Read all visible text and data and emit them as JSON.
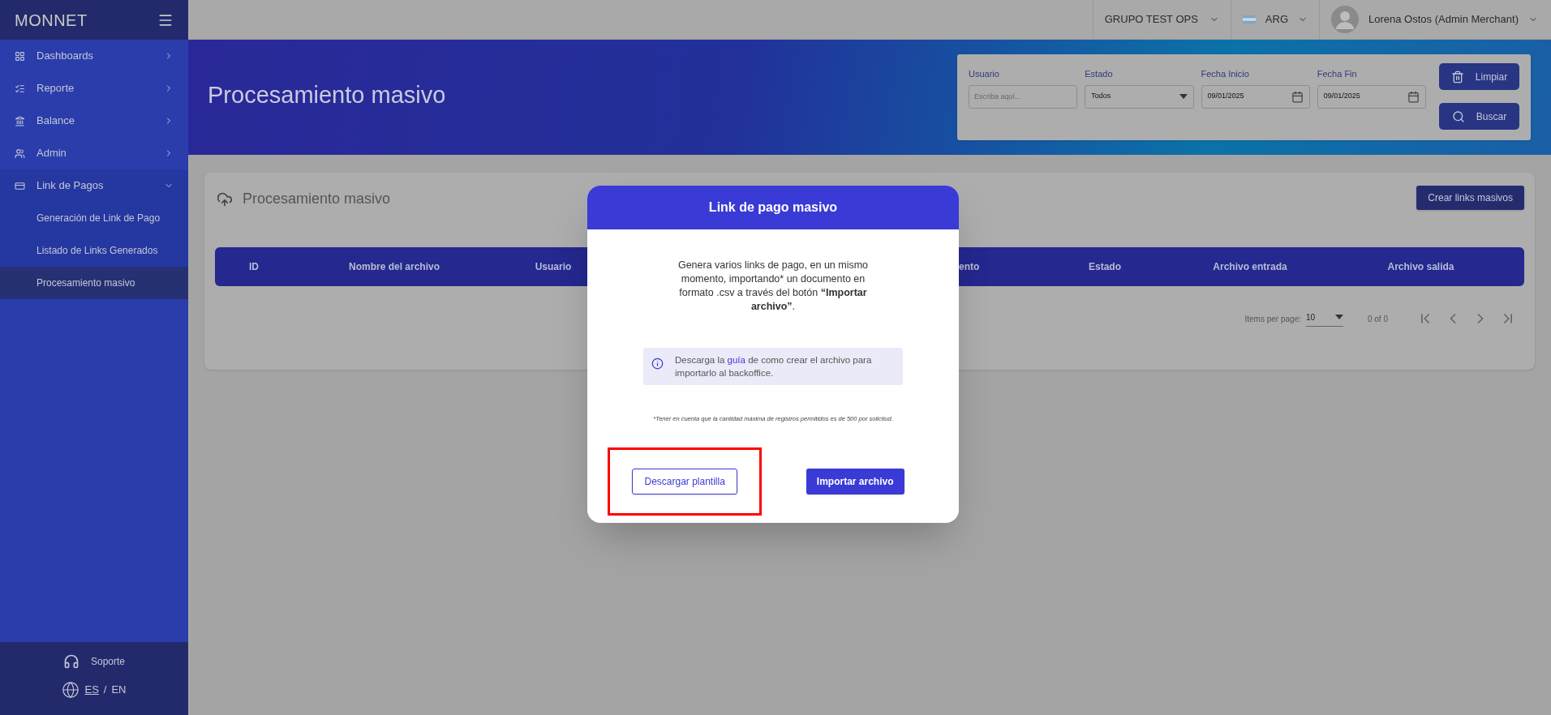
{
  "sidebar": {
    "logo": "MONNET",
    "items": [
      {
        "label": "Dashboards",
        "kind": "dashboards",
        "expanded": false
      },
      {
        "label": "Reporte",
        "kind": "report",
        "expanded": false
      },
      {
        "label": "Balance",
        "kind": "balance",
        "expanded": false
      },
      {
        "label": "Admin",
        "kind": "admin",
        "expanded": false
      },
      {
        "label": "Link de Pagos",
        "kind": "payments",
        "expanded": true,
        "children": [
          {
            "label": "Generación de Link de Pago",
            "selected": false
          },
          {
            "label": "Listado de Links Generados",
            "selected": false
          },
          {
            "label": "Procesamiento masivo",
            "selected": true
          }
        ]
      }
    ],
    "support": "Soporte",
    "languages": [
      {
        "label": "ES",
        "selected": true
      },
      {
        "label": "EN",
        "selected": false
      }
    ],
    "language_separator": "/"
  },
  "topbar": {
    "group": "GRUPO TEST OPS",
    "country": "ARG",
    "user": "Lorena Ostos (Admin Merchant)"
  },
  "page_title": "Procesamiento masivo",
  "filters": {
    "fields": [
      {
        "label": "Usuario",
        "kind": "text",
        "placeholder": "Escriba aquí..."
      },
      {
        "label": "Estado",
        "kind": "select",
        "value": "Todos"
      },
      {
        "label": "Fecha Inicio",
        "kind": "date",
        "value": "09/01/2025"
      },
      {
        "label": "Fecha Fin",
        "kind": "date",
        "value": "09/01/2025"
      }
    ],
    "buttons": [
      {
        "label": "Limpiar",
        "kind": "clear"
      },
      {
        "label": "Buscar",
        "kind": "search"
      }
    ]
  },
  "card": {
    "title": "Procesamiento masivo",
    "button": "Crear links masivos",
    "table": {
      "columns": [
        "ID",
        "Nombre del archivo",
        "Usuario",
        "ento",
        "Estado",
        "Archivo entrada",
        "Archivo salida"
      ]
    },
    "pagination": {
      "items_per_page_label": "Items per page:",
      "items_per_page": "10",
      "range": "0 of 0"
    }
  },
  "modal": {
    "title": "Link de pago masivo",
    "description": "Genera varios links de pago, en un mismo momento, importando* un documento en formato .csv a través del botón **“Importar archivo”**.",
    "info": {
      "before": "Descarga la ",
      "link": "guía",
      "after": " de como crear el archivo para importarlo al backoffice."
    },
    "note": "*Tener en cuenta que la cantidad máxima de registros permitidos es de 500 por solicitud.",
    "buttons": [
      {
        "label": "Descargar plantilla",
        "kind": "outline"
      },
      {
        "label": "Importar archivo",
        "kind": "primary"
      }
    ]
  }
}
